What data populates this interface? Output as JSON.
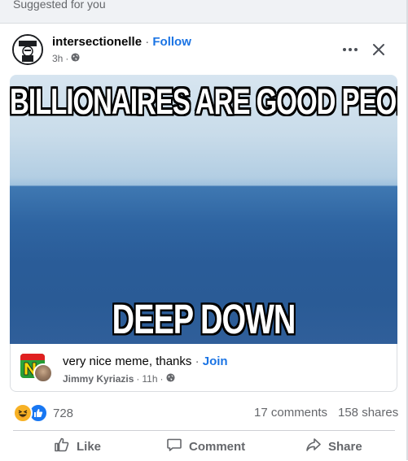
{
  "feed": {
    "suggested_label": "Suggested for you"
  },
  "post": {
    "author": "intersectionelle",
    "separator": "·",
    "follow_label": "Follow",
    "time": "3h",
    "audience_icon": "globe-icon",
    "more_icon": "more-options-icon",
    "close_icon": "close-icon",
    "meme": {
      "top_text": "BILLIONAIRES ARE GOOD PEOPLE",
      "bottom_text": "DEEP DOWN"
    },
    "shared_from": {
      "group_name": "very nice meme, thanks",
      "separator": "·",
      "join_label": "Join",
      "poster": "Jimmy Kyriazis",
      "time": "11h",
      "audience_icon": "globe-icon"
    },
    "stats": {
      "reactions": [
        "haha",
        "like"
      ],
      "reaction_count": "728",
      "comments": "17 comments",
      "shares": "158 shares"
    },
    "actions": {
      "like_label": "Like",
      "comment_label": "Comment",
      "share_label": "Share"
    }
  },
  "colors": {
    "link_blue": "#1b74e4",
    "muted_text": "#65676b",
    "like_blue": "#1877f2",
    "haha_yellow": "#f7b125"
  }
}
